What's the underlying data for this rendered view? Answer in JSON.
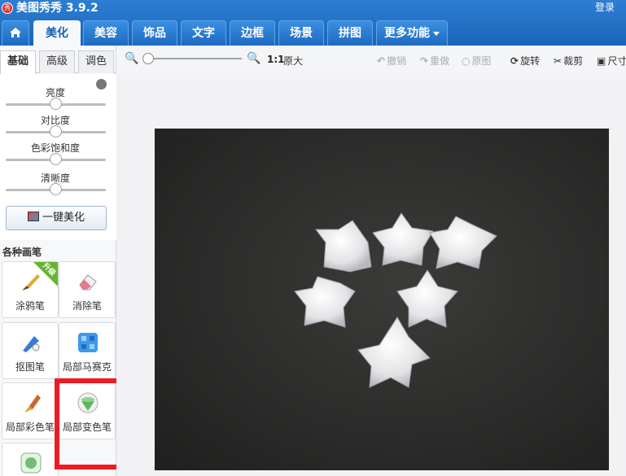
{
  "app": {
    "title": "美图秀秀 3.9.2",
    "logo": "秀",
    "login": "登录"
  },
  "tabs": [
    {
      "label": "美化"
    },
    {
      "label": "美容"
    },
    {
      "label": "饰品"
    },
    {
      "label": "文字"
    },
    {
      "label": "边框"
    },
    {
      "label": "场景"
    },
    {
      "label": "拼图"
    },
    {
      "label": "更多功能"
    }
  ],
  "subtabs": {
    "basic": "基础",
    "advanced": "高级",
    "color": "调色"
  },
  "adjust": {
    "brightness": {
      "label": "亮度",
      "value": 0.5
    },
    "contrast": {
      "label": "对比度",
      "value": 0.5
    },
    "saturation": {
      "label": "色彩饱和度",
      "value": 0.5
    },
    "sharpness": {
      "label": "清晰度",
      "value": 0.5
    }
  },
  "onekey": "一键美化",
  "brushes": {
    "title": "各种画笔",
    "doodle": "涂鸦笔",
    "upgrade_badge": "升级",
    "eraser": "消除笔",
    "cutout": "抠图笔",
    "mosaic": "局部马赛克",
    "local_color": "局部彩色笔",
    "color_change": "局部变色笔"
  },
  "toolbar": {
    "ratio": "1:1",
    "original_size": "原大",
    "undo": "撤销",
    "redo": "重做",
    "original": "原图",
    "rotate": "旋转",
    "crop": "裁剪",
    "resize": "尺寸"
  },
  "colors": {
    "accent": "#1a64b8",
    "highlight": "#ee1b24",
    "upgrade": "#67b52f"
  }
}
